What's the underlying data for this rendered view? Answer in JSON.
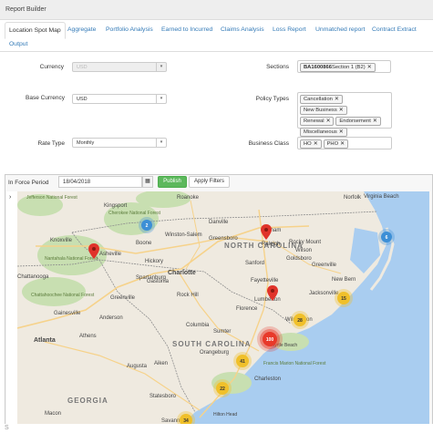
{
  "window": {
    "title": "Report Builder"
  },
  "tabs": [
    {
      "label": "Location Spot Map",
      "active": true
    },
    {
      "label": "Aggregate"
    },
    {
      "label": "Portfolio Analysis"
    },
    {
      "label": "Earned to Incurred"
    },
    {
      "label": "Claims Analysis"
    },
    {
      "label": "Loss Report"
    },
    {
      "label": "Unmatched report"
    },
    {
      "label": "Contract Extract"
    },
    {
      "label": "Output"
    }
  ],
  "form": {
    "currency": {
      "label": "Currency",
      "value": "USD"
    },
    "base_currency": {
      "label": "Base Currency",
      "value": "USD"
    },
    "rate_type": {
      "label": "Rate Type",
      "value": "Monthly"
    },
    "sections": {
      "label": "Sections",
      "chip_bold": "BA1600866",
      "chip_rest": "Section 1 (B2)"
    },
    "policy_types": {
      "label": "Policy Types",
      "chips": [
        "Cancellation",
        "New Business",
        "Renewal",
        "Endorsement",
        "Miscellaneous"
      ]
    },
    "business_class": {
      "label": "Business Class",
      "chips": [
        "HO",
        "PHO"
      ]
    }
  },
  "map_toolbar": {
    "in_force_label": "In Force Period",
    "date_value": "18/04/2018",
    "publish_label": "Publish",
    "apply_label": "Apply Filters",
    "calendar_icon": "calendar-icon"
  },
  "map": {
    "colors": {
      "land": "#efeae0",
      "water": "#a9cdf0",
      "forest": "#c8dfb1",
      "road": "#f6d28a",
      "state_border": "#8e8e8e",
      "cluster_blue": "#3d8fd6",
      "cluster_yellow": "#f0c02a",
      "cluster_red": "#e8392a",
      "pin": "#e0332a"
    },
    "places": {
      "charlotte": "Charlotte",
      "north_carolina": "NORTH CAROLINA",
      "south_carolina": "SOUTH CAROLINA",
      "georgia": "GEORGIA",
      "atlanta": "Atlanta",
      "columbia": "Columbia",
      "greensboro": "Greensboro",
      "winston_salem": "Winston-Salem",
      "raleigh": "Raleigh",
      "durham": "Durham",
      "fayetteville": "Fayetteville",
      "wilmington": "Wilmington",
      "knoxville": "Knoxville",
      "asheville": "Asheville",
      "greenville": "Greenville",
      "spartanburg": "Spartanburg",
      "augusta": "Augusta",
      "savannah": "Savannah",
      "charleston": "Charleston",
      "athens": "Athens",
      "macon": "Macon",
      "norfolk": "Norfolk",
      "virginia_beach": "Virginia Beach",
      "jacksonville": "Jacksonville",
      "rocky_mount": "Rocky Mount",
      "greenville_nc": "Greenville",
      "kingsport": "Kingsport",
      "roanoke": "Roanoke",
      "danville": "Danville",
      "gastonia": "Gastonia",
      "rock_hill": "Rock Hill",
      "florence": "Florence",
      "myrtle_beach": "Myrtle Beach",
      "sumter": "Sumter",
      "new_bern": "New Bern",
      "goldsboro": "Goldsboro",
      "wilson": "Wilson",
      "chattanooga": "Chattanooga",
      "gainesville": "Gainesville",
      "anderson": "Anderson",
      "aiken": "Aiken",
      "hickory": "Hickory",
      "boone": "Boone",
      "sanford": "Sanford",
      "lumberton": "Lumberton",
      "orangeburg": "Orangeburg",
      "statesboro": "Statesboro",
      "hilton_head": "Hilton Head",
      "cherokee_nf": "Cherokee National Forest",
      "nantahala_nf": "Nantahala National Forest",
      "chattahoochee_nf": "Chattahoochee National Forest",
      "jefferson_nf": "Jefferson National Forest",
      "francis_marion": "Francis Marion National Forest"
    },
    "clusters": [
      {
        "id": "c2",
        "count": "2"
      },
      {
        "id": "c6",
        "count": "6"
      },
      {
        "id": "c15",
        "count": "15"
      },
      {
        "id": "c28",
        "count": "28"
      },
      {
        "id": "c100",
        "count": "100"
      },
      {
        "id": "c41",
        "count": "41"
      },
      {
        "id": "c22",
        "count": "22"
      },
      {
        "id": "c34",
        "count": "34"
      }
    ],
    "pins": [
      "pin-asheville",
      "pin-raleigh",
      "pin-fayetteville"
    ]
  },
  "bottom": {
    "label": "S"
  }
}
